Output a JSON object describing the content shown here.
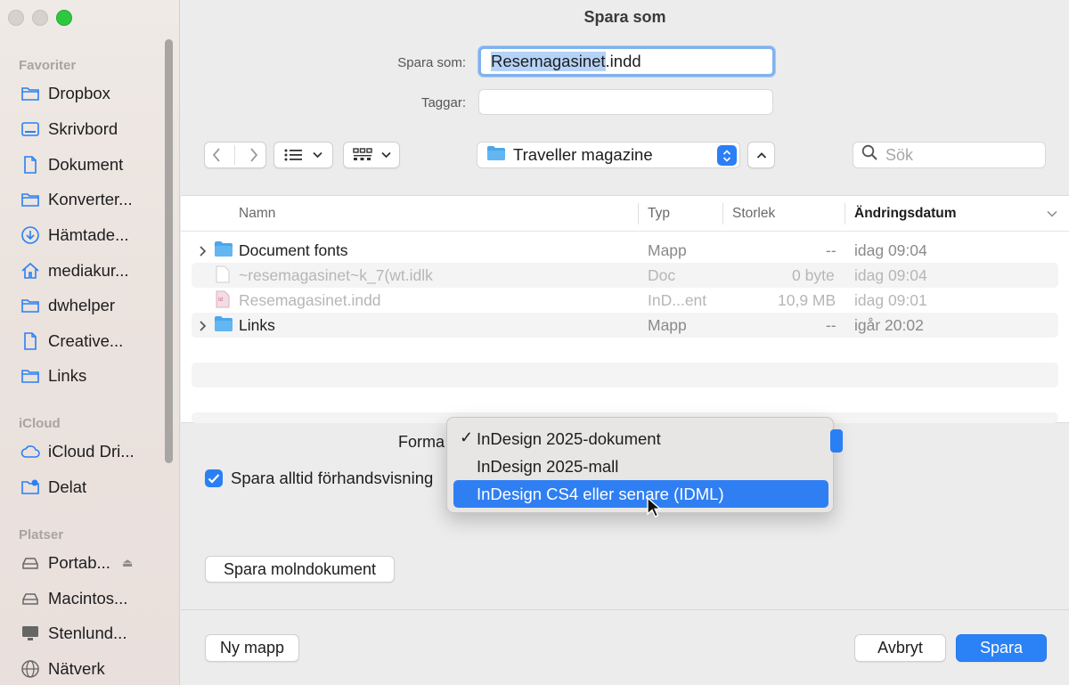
{
  "window": {
    "title": "Spara som"
  },
  "sidebar": {
    "sections": [
      {
        "label": "Favoriter",
        "items": [
          {
            "label": "Dropbox",
            "icon": "folder-icon"
          },
          {
            "label": "Skrivbord",
            "icon": "desktop-icon"
          },
          {
            "label": "Dokument",
            "icon": "document-icon"
          },
          {
            "label": "Konverter...",
            "icon": "folder-icon"
          },
          {
            "label": "Hämtade...",
            "icon": "download-icon"
          },
          {
            "label": "mediakur...",
            "icon": "home-icon"
          },
          {
            "label": "dwhelper",
            "icon": "folder-icon"
          },
          {
            "label": "Creative...",
            "icon": "document-icon"
          },
          {
            "label": "Links",
            "icon": "folder-icon"
          }
        ]
      },
      {
        "label": "iCloud",
        "items": [
          {
            "label": "iCloud Dri...",
            "icon": "cloud-icon"
          },
          {
            "label": "Delat",
            "icon": "shared-folder-icon"
          }
        ]
      },
      {
        "label": "Platser",
        "items": [
          {
            "label": "Portab...",
            "icon": "drive-icon"
          },
          {
            "label": "Macintos...",
            "icon": "drive-icon"
          },
          {
            "label": "Stenlund...",
            "icon": "display-icon"
          },
          {
            "label": "Nätverk",
            "icon": "network-icon"
          }
        ]
      }
    ]
  },
  "form": {
    "save_as_label": "Spara som:",
    "filename_selected": "Resemagasinet",
    "filename_ext": ".indd",
    "tags_label": "Taggar:",
    "tags_value": ""
  },
  "toolbar": {
    "location": "Traveller magazine",
    "search_placeholder": "Sök"
  },
  "filelist": {
    "columns": [
      "Namn",
      "Typ",
      "Storlek",
      "Ändringsdatum"
    ],
    "rows": [
      {
        "name": "Document fonts",
        "type": "Mapp",
        "size": "--",
        "date": "idag 09:04",
        "kind": "folder",
        "dimmed": false
      },
      {
        "name": "~resemagasinet~k_7(wt.idlk",
        "type": "Doc",
        "size": "0 byte",
        "date": "idag 09:04",
        "kind": "doc",
        "dimmed": true
      },
      {
        "name": "Resemagasinet.indd",
        "type": "InD...ent",
        "size": "10,9 MB",
        "date": "idag 09:01",
        "kind": "indd",
        "dimmed": true
      },
      {
        "name": "Links",
        "type": "Mapp",
        "size": "--",
        "date": "igår 20:02",
        "kind": "folder",
        "dimmed": false
      }
    ]
  },
  "options": {
    "format_label": "Forma",
    "preview_checkbox_label": "Spara alltid förhandsvisning",
    "preview_checked": true,
    "cloud_button": "Spara molndokument"
  },
  "format_menu": {
    "items": [
      {
        "label": "InDesign 2025-dokument",
        "checked": true,
        "highlighted": false
      },
      {
        "label": "InDesign 2025-mall",
        "checked": false,
        "highlighted": false
      },
      {
        "label": "InDesign CS4 eller senare (IDML)",
        "checked": false,
        "highlighted": true
      }
    ],
    "check_glyph": "✓"
  },
  "footer": {
    "new_folder": "Ny mapp",
    "cancel": "Avbryt",
    "save": "Spara"
  },
  "colors": {
    "accent": "#2a82f6",
    "highlight": "#2f7ff3",
    "folder": "#4ba6ea"
  }
}
